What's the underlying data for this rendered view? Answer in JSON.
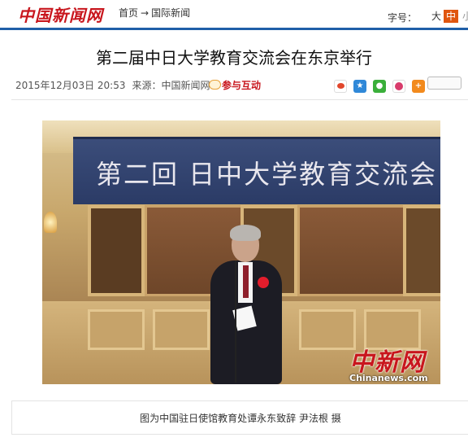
{
  "header": {
    "logo_text": "中国新闻网",
    "breadcrumb": {
      "home": "首页",
      "arrow": "→",
      "section": "国际新闻"
    },
    "font_size": {
      "label": "字号：",
      "large": "大",
      "medium": "中",
      "small": "小"
    },
    "accent_color": "#1f5fa8",
    "brand_color": "#c8161d"
  },
  "article": {
    "title": "第二届中日大学教育交流会在东京举行",
    "datetime": "2015年12月03日 20:53",
    "source": "来源：中国新闻网",
    "interact_label": "参与互动",
    "share_icons": [
      "weibo-icon",
      "qzone-icon",
      "wechat-icon",
      "renren-icon",
      "more-share-icon"
    ],
    "photo": {
      "banner_text": "第二回  日中大学教育交流会",
      "watermark": "中新网",
      "watermark_sub": "Chinanews.com"
    },
    "caption": "图为中国驻日使馆教育处谭永东致辞    尹法根    摄"
  }
}
